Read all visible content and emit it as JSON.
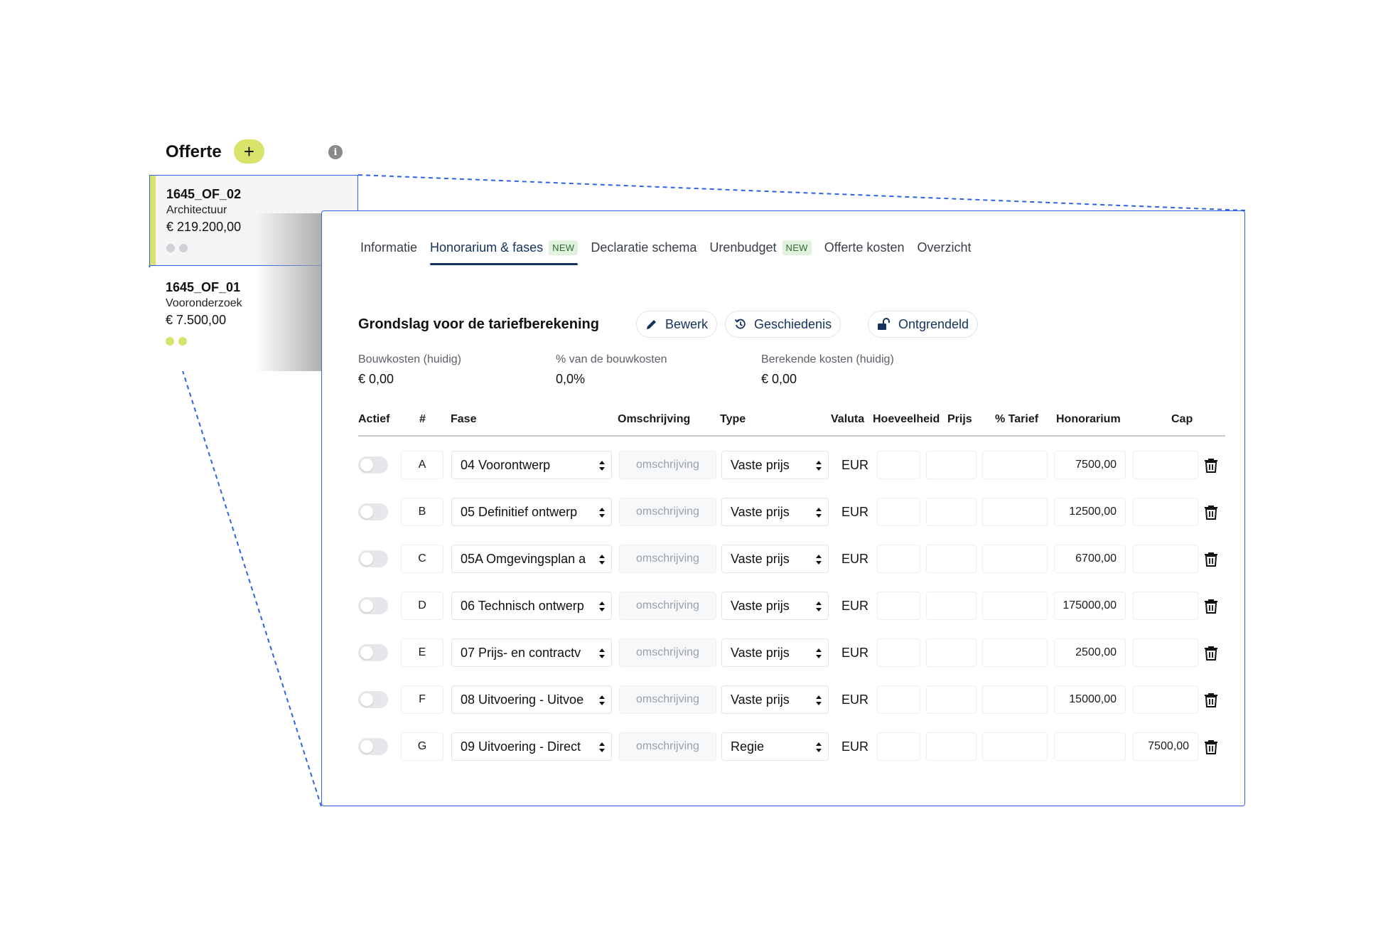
{
  "offer_list": {
    "title": "Offerte",
    "add_label": "+",
    "info_label": "i",
    "cards": [
      {
        "code": "1645_OF_02",
        "subtitle": "Architectuur",
        "amount": "€ 219.200,00"
      },
      {
        "code": "1645_OF_01",
        "subtitle": "Vooronderzoek",
        "amount": "€ 7.500,00"
      }
    ]
  },
  "tabs": [
    {
      "label": "Informatie",
      "badge": ""
    },
    {
      "label": "Honorarium & fases",
      "badge": "NEW"
    },
    {
      "label": "Declaratie schema",
      "badge": ""
    },
    {
      "label": "Urenbudget",
      "badge": "NEW"
    },
    {
      "label": "Offerte kosten",
      "badge": ""
    },
    {
      "label": "Overzicht",
      "badge": ""
    }
  ],
  "active_tab": "Honorarium & fases",
  "section": {
    "title": "Grondslag voor de tariefberekening",
    "buttons": {
      "edit": "Bewerk",
      "history": "Geschiedenis",
      "lock": "Ontgrendeld"
    },
    "stats": [
      {
        "label": "Bouwkosten (huidig)",
        "value": "€ 0,00"
      },
      {
        "label": "% van de bouwkosten",
        "value": "0,0%"
      },
      {
        "label": "Berekende kosten (huidig)",
        "value": "€ 0,00"
      }
    ]
  },
  "table": {
    "headers": {
      "active": "Actief",
      "num": "#",
      "phase": "Fase",
      "desc": "Omschrijving",
      "type": "Type",
      "currency": "Valuta",
      "qty": "Hoeveelheid",
      "price": "Prijs",
      "rate": "% Tarief",
      "fee": "Honorarium",
      "cap": "Cap"
    },
    "desc_placeholder": "omschrijving",
    "rows": [
      {
        "id": "A",
        "phase": "04 Voorontwerp",
        "type": "Vaste prijs",
        "currency": "EUR",
        "fee": "7500,00",
        "cap": ""
      },
      {
        "id": "B",
        "phase": "05 Definitief ontwerp",
        "type": "Vaste prijs",
        "currency": "EUR",
        "fee": "12500,00",
        "cap": ""
      },
      {
        "id": "C",
        "phase": "05A Omgevingsplan a",
        "type": "Vaste prijs",
        "currency": "EUR",
        "fee": "6700,00",
        "cap": ""
      },
      {
        "id": "D",
        "phase": "06 Technisch ontwerp",
        "type": "Vaste prijs",
        "currency": "EUR",
        "fee": "175000,00",
        "cap": ""
      },
      {
        "id": "E",
        "phase": "07 Prijs- en contractv",
        "type": "Vaste prijs",
        "currency": "EUR",
        "fee": "2500,00",
        "cap": ""
      },
      {
        "id": "F",
        "phase": "08 Uitvoering - Uitvoe",
        "type": "Vaste prijs",
        "currency": "EUR",
        "fee": "15000,00",
        "cap": ""
      },
      {
        "id": "G",
        "phase": "09 Uitvoering - Direct",
        "type": "Regie",
        "currency": "EUR",
        "fee": "",
        "cap": "7500,00"
      }
    ]
  },
  "colors": {
    "accent": "#d7e36a",
    "brand": "#14325c",
    "highlight_border": "#2f63e6",
    "new_badge_bg": "#e1f3dd"
  }
}
